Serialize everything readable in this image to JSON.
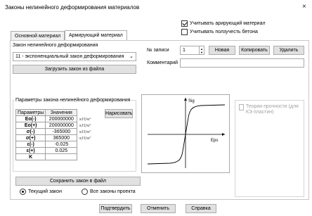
{
  "window": {
    "title": "Законы нелинейного деформирования материалов",
    "close": "×"
  },
  "top_options": [
    {
      "label": "Учитывать арирующий материал",
      "checked": true
    },
    {
      "label": "Учитывать ползучесть бетона",
      "checked": false
    }
  ],
  "tabs": [
    {
      "label": "Основной материал",
      "active": false
    },
    {
      "label": "Армирующий материал",
      "active": true
    }
  ],
  "law": {
    "heading": "Закон нелинейного деформирования",
    "selected": "11 - экспоненциальный закон деформирования",
    "load_button": "Загрузить закон из файла"
  },
  "record": {
    "label": "№ записи",
    "value": "1",
    "new_button": "Новая",
    "copy_button": "Копировать",
    "delete_button": "Удалить",
    "comment_label": "Комментарий",
    "comment_value": ""
  },
  "params": {
    "group_title": "Параметры закона нелинейного деформирования",
    "col_param": "Параметры",
    "col_value": "Значения",
    "draw_button": "Нарисовать",
    "rows": [
      {
        "name": "Eo(-)",
        "value": "200000000",
        "unit": "кН/м²"
      },
      {
        "name": "Eo(+)",
        "value": "200000000",
        "unit": "кН/м²"
      },
      {
        "name": "σ(-)",
        "value": "-365000",
        "unit": "кН/м²"
      },
      {
        "name": "σ(+)",
        "value": "365000",
        "unit": "кН/м²"
      },
      {
        "name": "ε(-)",
        "value": "-0.025",
        "unit": ""
      },
      {
        "name": "ε(+)",
        "value": "0.025",
        "unit": ""
      },
      {
        "name": "K",
        "value": "",
        "unit": ""
      }
    ]
  },
  "graph": {
    "y_label": "Sig",
    "x_label": "Eps"
  },
  "strength": {
    "label": "Теории прочности (для КЭ пластин)",
    "checked": false,
    "enabled": false
  },
  "save_button": "Сохранить закон в файл",
  "scope": [
    {
      "label": "Текущий закон",
      "selected": true
    },
    {
      "label": "Все законы проекта",
      "selected": false
    }
  ],
  "footer": {
    "confirm": "Подтвердить",
    "cancel": "Отменить",
    "help": "Справка"
  }
}
